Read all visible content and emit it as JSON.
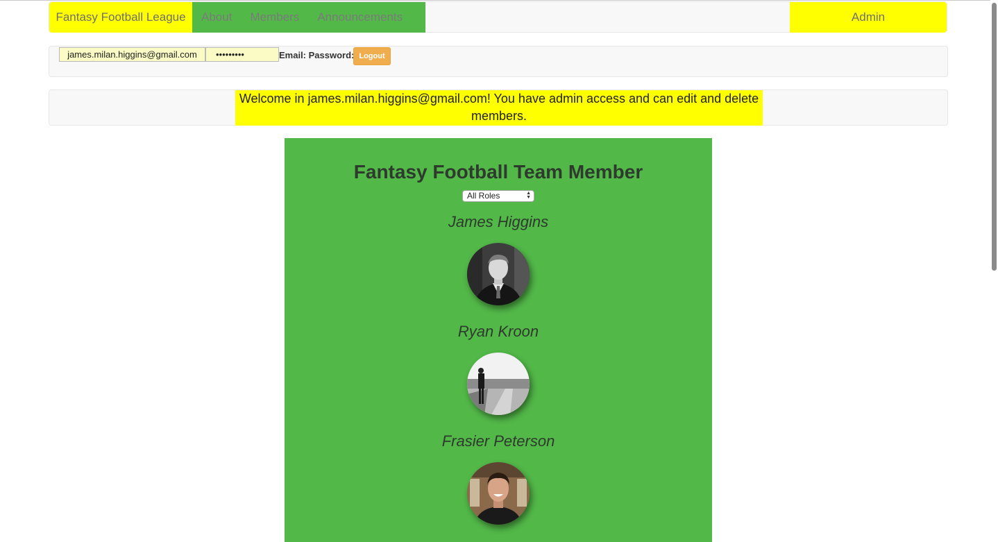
{
  "navbar": {
    "brand": "Fantasy Football League",
    "links": [
      "About",
      "Members",
      "Announcements"
    ],
    "admin": "Admin"
  },
  "login": {
    "email_value": "james.milan.higgins@gmail.com",
    "password_value": "•••••••••",
    "labels": "Email: Password:",
    "logout_label": "Logout"
  },
  "welcome": {
    "message": "Welcome in james.milan.higgins@gmail.com! You have admin access and can edit and delete members."
  },
  "team": {
    "title": "Fantasy Football Team Member",
    "role_filter": "All Roles",
    "members": [
      {
        "name": "James Higgins"
      },
      {
        "name": "Ryan Kroon"
      },
      {
        "name": "Frasier Peterson"
      }
    ]
  },
  "colors": {
    "highlight": "#ffff00",
    "panel_green": "#52b848",
    "logout_orange": "#f0ad4e"
  }
}
